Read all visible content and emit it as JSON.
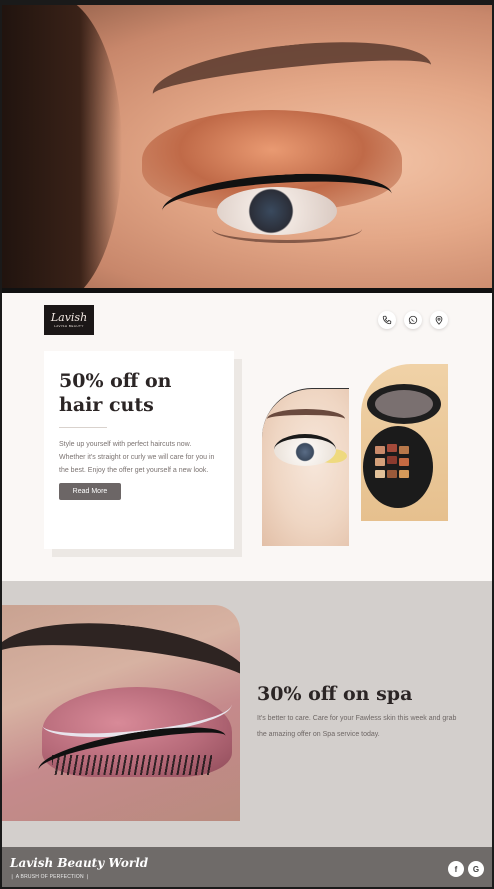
{
  "brand": {
    "logo_script": "Lavish",
    "logo_tag": "LAVISH BEAUTY",
    "footer_name": "Lavish Beauty World",
    "footer_tagline": "❘ A BRUSH OF PERFECTION ❘"
  },
  "header": {
    "icons": [
      "phone-icon",
      "whatsapp-icon",
      "location-icon"
    ]
  },
  "offer_card": {
    "title": "50% off on hair cuts",
    "description": "Style up yourself with perfect haircuts now. Whether it's straight or curly we will care for you in the best. Enjoy the offer get yourself a new look.",
    "button_label": "Read More"
  },
  "spa": {
    "title": "30% off on spa",
    "description": "It's better to care. Care for your Fawless skin this week and grab the amazing offer on Spa service today."
  },
  "footer": {
    "social": [
      "f",
      "G"
    ]
  },
  "colors": {
    "footer_bg": "#6f6b69",
    "section_bg": "#d3cfcc",
    "button_bg": "#6c6666"
  }
}
